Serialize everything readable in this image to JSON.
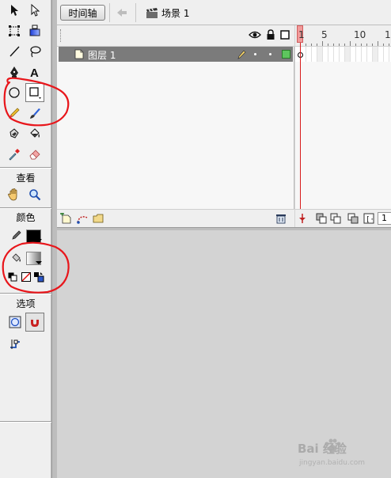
{
  "toolbar": {
    "view_label": "查看",
    "color_label": "颜色",
    "options_label": "选项"
  },
  "timeline": {
    "tab_label": "时间轴",
    "scene_label": "场景 1",
    "ruler_numbers": [
      "1",
      "5",
      "10",
      "1"
    ],
    "layer_name": "图层 1",
    "footer_frame_number": "1"
  },
  "colors": {
    "accent_red": "#e8161b",
    "playhead": "#f19a9a",
    "layer_selected": "#7b7b7b",
    "layer_outline_green": "#5ec55e"
  },
  "watermark": {
    "text": "Bai 经验",
    "sub": "jingyan.baidu.com"
  }
}
